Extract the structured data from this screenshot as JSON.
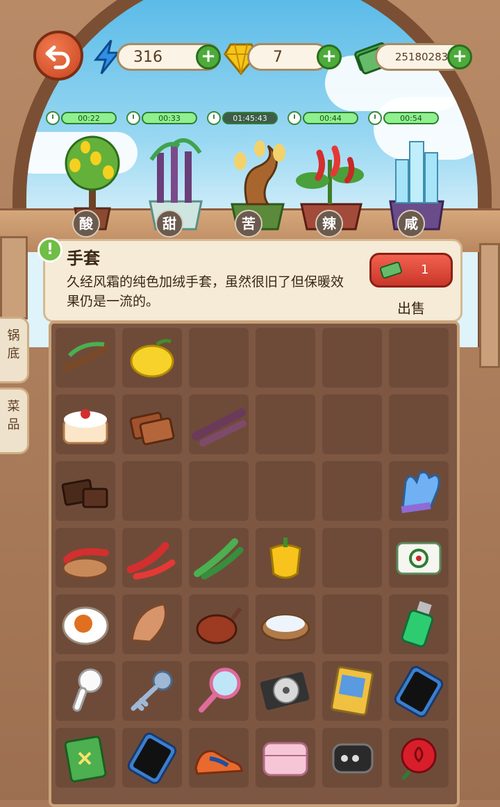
{
  "resources": {
    "energy": "316",
    "gems": "7",
    "cash": "25180283"
  },
  "timers": [
    "00:22",
    "00:33",
    "01:45:43",
    "00:44",
    "00:54"
  ],
  "plants": [
    {
      "label": "酸",
      "icon": "lemon-tree-icon"
    },
    {
      "label": "甜",
      "icon": "sugarcane-plant-icon"
    },
    {
      "label": "苦",
      "icon": "bitter-gourd-plant-icon"
    },
    {
      "label": "辣",
      "icon": "chili-plant-icon"
    },
    {
      "label": "咸",
      "icon": "salt-crystal-plant-icon"
    }
  ],
  "selected_item": {
    "title": "手套",
    "description": "久经风霜的纯色加绒手套，虽然很旧了但保暖效果仍是一流的。",
    "sell_count": "1",
    "sell_label": "出售"
  },
  "side_tabs": [
    "锅底",
    "菜品"
  ],
  "inventory": [
    [
      "tamarind-icon",
      "lemon-icon",
      "",
      "",
      "",
      ""
    ],
    [
      "cake-icon",
      "brown-sugar-icon",
      "sugarcane-icon",
      "",
      "",
      ""
    ],
    [
      "chocolate-icon",
      "",
      "",
      "",
      "",
      "glove-icon"
    ],
    [
      "chili-bowl-icon",
      "red-chili-icon",
      "green-chili-icon",
      "yellow-pepper-icon",
      "",
      "mahjong-tile-icon"
    ],
    [
      "salted-egg-icon",
      "dried-fish-icon",
      "ham-icon",
      "salt-bowl-icon",
      "",
      "lighter-icon"
    ],
    [
      "earbud-icon",
      "key-icon",
      "hand-mirror-icon",
      "cd-icon",
      "trading-card-icon",
      "phone-icon"
    ],
    [
      "notebook-icon",
      "phone-icon",
      "sneaker-icon",
      "pink-wallet-icon",
      "car-key-icon",
      "rose-icon"
    ]
  ]
}
